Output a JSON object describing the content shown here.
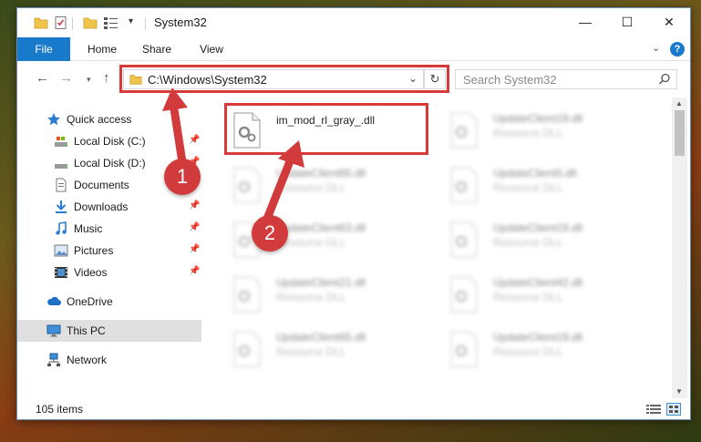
{
  "window": {
    "title": "System32",
    "minimize_glyph": "—",
    "maximize_glyph": "☐",
    "close_glyph": "✕"
  },
  "quick_access_toolbar": {
    "icons": [
      "folder-icon",
      "properties-icon",
      "new-folder-icon",
      "view-icon"
    ],
    "dropdown_glyph": "▾"
  },
  "ribbon": {
    "tabs": [
      {
        "label": "File",
        "active": true
      },
      {
        "label": "Home"
      },
      {
        "label": "Share"
      },
      {
        "label": "View"
      }
    ],
    "expand_glyph": "⌄",
    "help_glyph": "?"
  },
  "address_bar": {
    "back_glyph": "←",
    "forward_glyph": "→",
    "recent_glyph": "▾",
    "up_glyph": "↑",
    "path": "C:\\Windows\\System32",
    "chevron_glyph": "⌄",
    "refresh_glyph": "↻"
  },
  "search": {
    "placeholder": "Search System32"
  },
  "nav_pane": {
    "items": [
      {
        "label": "Quick access",
        "icon": "star-icon",
        "pinned": false
      },
      {
        "label": "Local Disk (C:)",
        "icon": "drive-icon",
        "pinned": true
      },
      {
        "label": "Local Disk (D:)",
        "icon": "drive-icon",
        "pinned": true
      },
      {
        "label": "Documents",
        "icon": "documents-icon",
        "pinned": true
      },
      {
        "label": "Downloads",
        "icon": "download-icon",
        "pinned": true
      },
      {
        "label": "Music",
        "icon": "music-icon",
        "pinned": true
      },
      {
        "label": "Pictures",
        "icon": "pictures-icon",
        "pinned": true
      },
      {
        "label": "Videos",
        "icon": "video-icon",
        "pinned": true
      },
      {
        "label": "OneDrive",
        "icon": "cloud-icon",
        "pinned": false
      },
      {
        "label": "This PC",
        "icon": "computer-icon",
        "pinned": false,
        "selected": true
      },
      {
        "label": "Network",
        "icon": "network-icon",
        "pinned": false
      }
    ],
    "pin_glyph": "📌"
  },
  "files": [
    {
      "name": "im_mod_rl_gray_.dll",
      "type": "",
      "highlighted": true
    },
    {
      "name": "UpdateClient19.dll",
      "type": "Resource DLL"
    },
    {
      "name": "UpdateClient65.dll",
      "type": "Resource DLL"
    },
    {
      "name": "UpdateClient5.dll",
      "type": "Resource DLL"
    },
    {
      "name": "UpdateClient63.dll",
      "type": "Resource DLL"
    },
    {
      "name": "UpdateClient19.dll",
      "type": "Resource DLL"
    },
    {
      "name": "UpdateClient21.dll",
      "type": "Resource DLL"
    },
    {
      "name": "UpdateClient42.dll",
      "type": "Resource DLL"
    },
    {
      "name": "UpdateClient65.dll",
      "type": "Resource DLL"
    },
    {
      "name": "UpdateClient19.dll",
      "type": "Resource DLL"
    }
  ],
  "scrollbar": {
    "up_glyph": "▲",
    "down_glyph": "▼"
  },
  "status_bar": {
    "item_count": "105 items"
  },
  "callouts": {
    "step1": "1",
    "step2": "2"
  },
  "colors": {
    "accent": "#1979ca",
    "highlight_red": "#d83a3a",
    "callout_red": "#d23b3b"
  }
}
